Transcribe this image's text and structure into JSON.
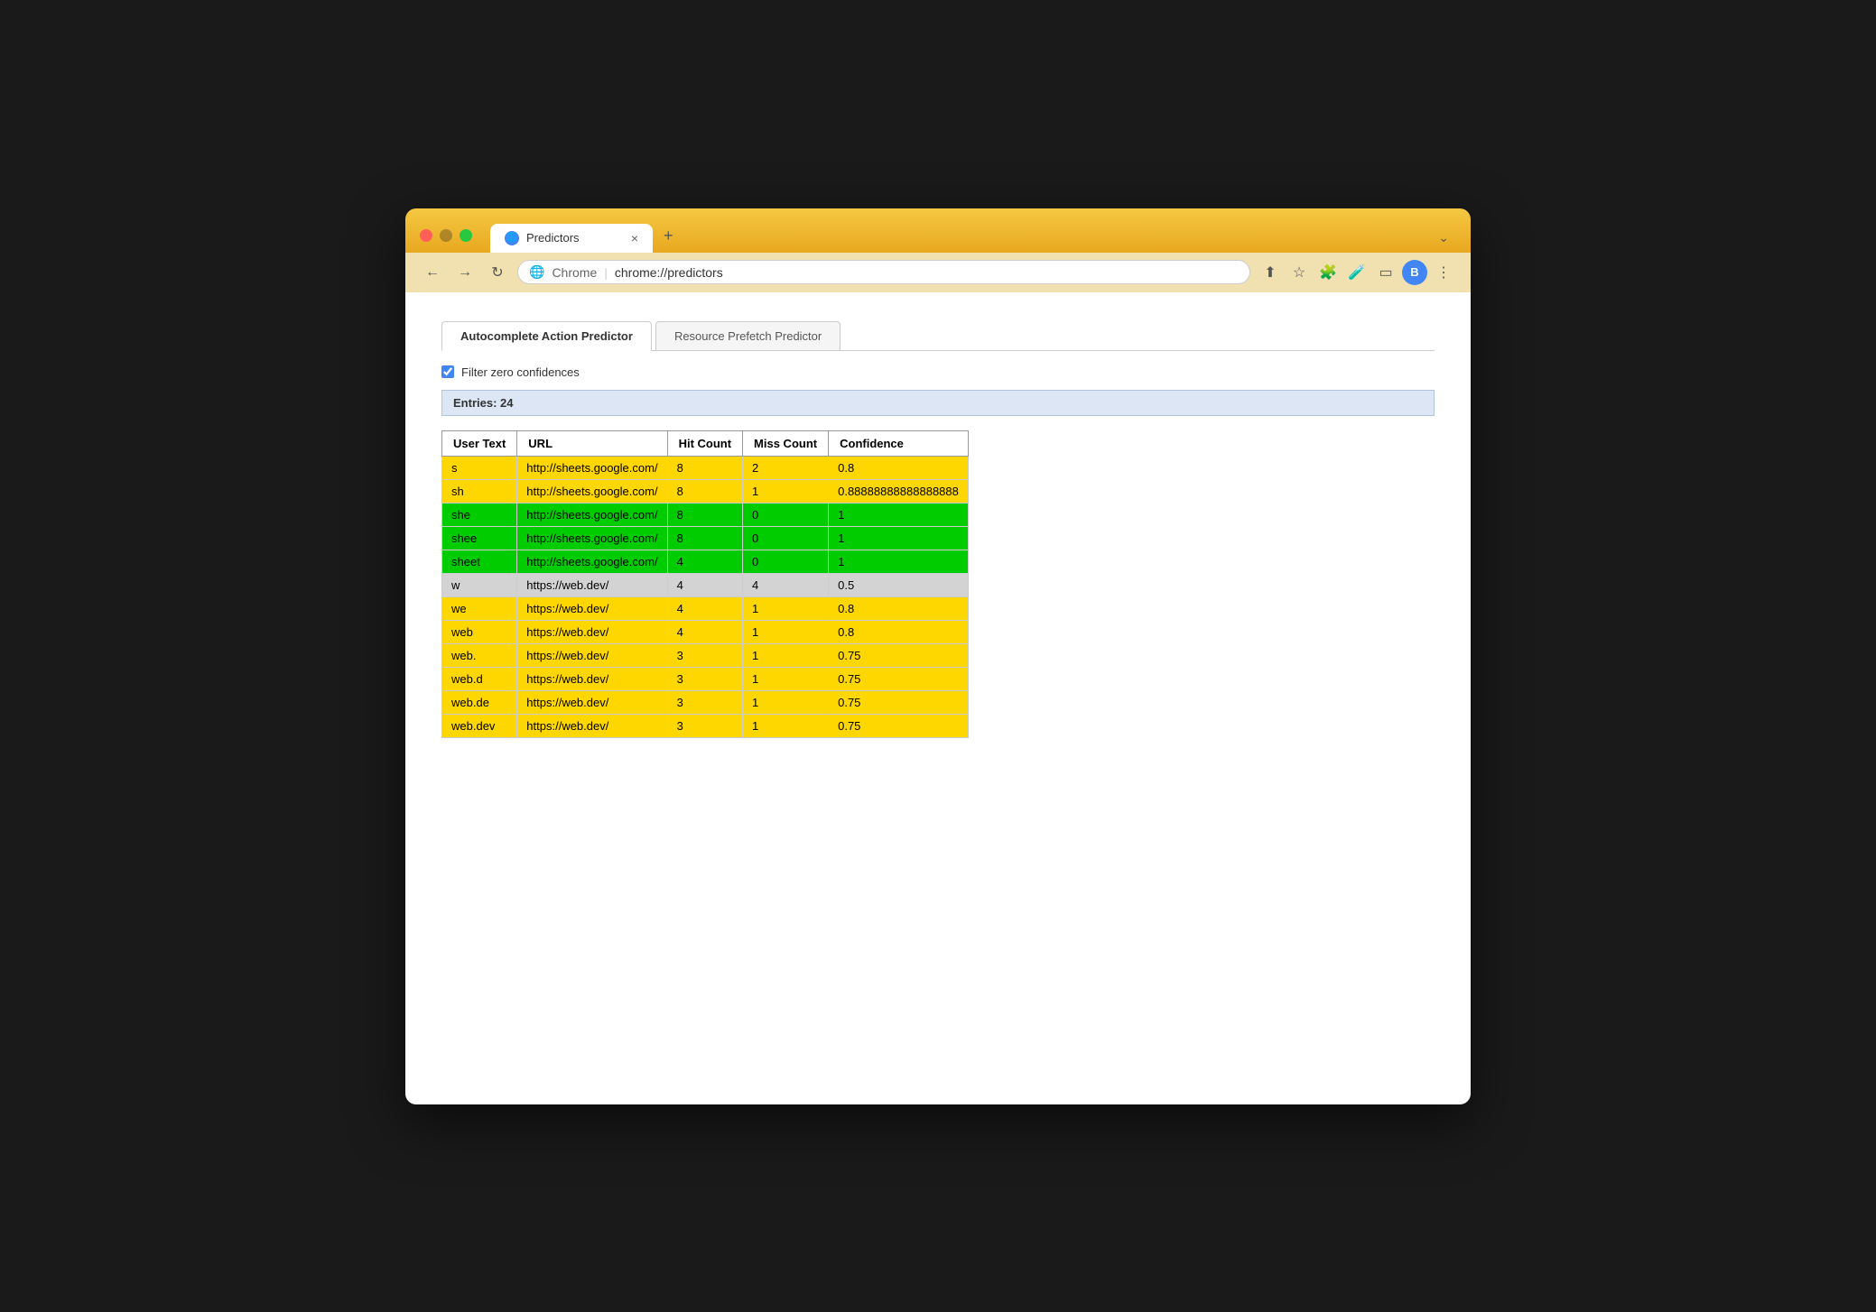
{
  "browser": {
    "tab_title": "Predictors",
    "tab_close": "×",
    "tab_new": "+",
    "tab_more": "⌄",
    "nav_back": "←",
    "nav_forward": "→",
    "nav_reload": "↻",
    "address_prefix": "Chrome",
    "address_separator": "|",
    "address_url": "chrome://predictors",
    "action_share": "⬆",
    "action_star": "☆",
    "action_extensions": "🧩",
    "action_beaker": "🧪",
    "action_sidebar": "▭",
    "action_menu": "⋮",
    "user_avatar": "B"
  },
  "page": {
    "tabs": [
      {
        "id": "autocomplete",
        "label": "Autocomplete Action Predictor",
        "active": true
      },
      {
        "id": "resource",
        "label": "Resource Prefetch Predictor",
        "active": false
      }
    ],
    "filter_label": "Filter zero confidences",
    "filter_checked": true,
    "entries_label": "Entries: 24",
    "table": {
      "headers": [
        "User Text",
        "URL",
        "Hit Count",
        "Miss Count",
        "Confidence"
      ],
      "rows": [
        {
          "user_text": "s",
          "url": "http://sheets.google.com/",
          "hit_count": "8",
          "miss_count": "2",
          "confidence": "0.8",
          "color": "yellow"
        },
        {
          "user_text": "sh",
          "url": "http://sheets.google.com/",
          "hit_count": "8",
          "miss_count": "1",
          "confidence": "0.88888888888888888",
          "color": "yellow"
        },
        {
          "user_text": "she",
          "url": "http://sheets.google.com/",
          "hit_count": "8",
          "miss_count": "0",
          "confidence": "1",
          "color": "green"
        },
        {
          "user_text": "shee",
          "url": "http://sheets.google.com/",
          "hit_count": "8",
          "miss_count": "0",
          "confidence": "1",
          "color": "green"
        },
        {
          "user_text": "sheet",
          "url": "http://sheets.google.com/",
          "hit_count": "4",
          "miss_count": "0",
          "confidence": "1",
          "color": "green"
        },
        {
          "user_text": "w",
          "url": "https://web.dev/",
          "hit_count": "4",
          "miss_count": "4",
          "confidence": "0.5",
          "color": "gray"
        },
        {
          "user_text": "we",
          "url": "https://web.dev/",
          "hit_count": "4",
          "miss_count": "1",
          "confidence": "0.8",
          "color": "yellow"
        },
        {
          "user_text": "web",
          "url": "https://web.dev/",
          "hit_count": "4",
          "miss_count": "1",
          "confidence": "0.8",
          "color": "yellow"
        },
        {
          "user_text": "web.",
          "url": "https://web.dev/",
          "hit_count": "3",
          "miss_count": "1",
          "confidence": "0.75",
          "color": "yellow"
        },
        {
          "user_text": "web.d",
          "url": "https://web.dev/",
          "hit_count": "3",
          "miss_count": "1",
          "confidence": "0.75",
          "color": "yellow"
        },
        {
          "user_text": "web.de",
          "url": "https://web.dev/",
          "hit_count": "3",
          "miss_count": "1",
          "confidence": "0.75",
          "color": "yellow"
        },
        {
          "user_text": "web.dev",
          "url": "https://web.dev/",
          "hit_count": "3",
          "miss_count": "1",
          "confidence": "0.75",
          "color": "yellow"
        }
      ]
    }
  }
}
